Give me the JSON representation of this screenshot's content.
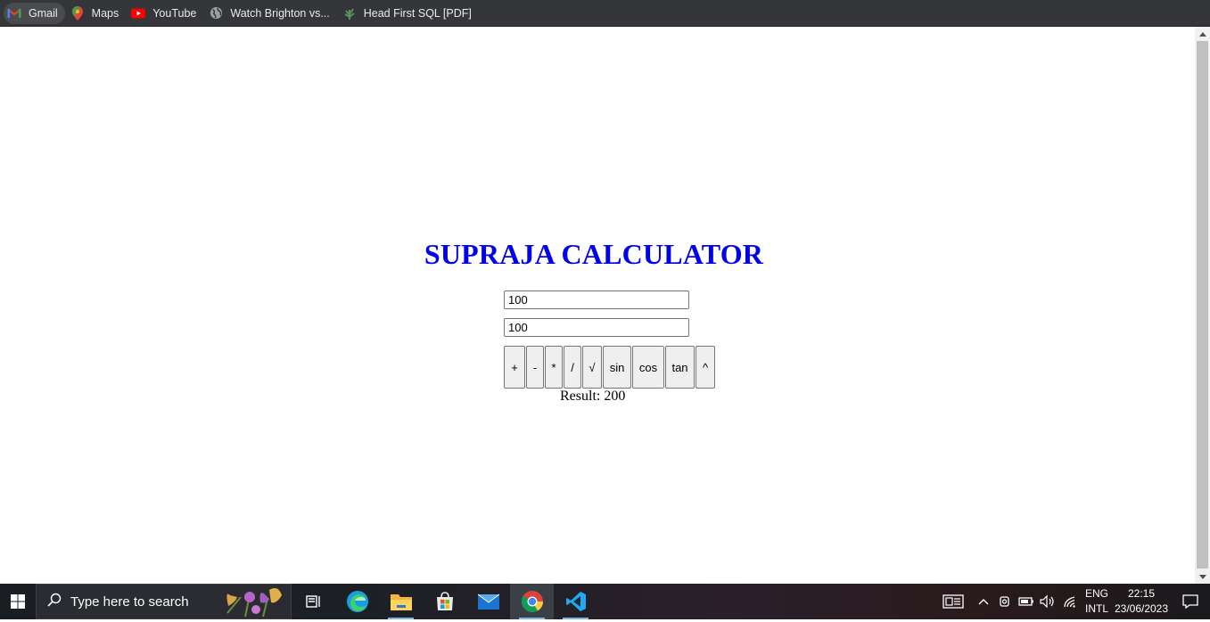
{
  "bookmarks": [
    {
      "label": "Gmail",
      "icon": "gmail-icon"
    },
    {
      "label": "Maps",
      "icon": "maps-icon"
    },
    {
      "label": "YouTube",
      "icon": "youtube-icon"
    },
    {
      "label": "Watch Brighton vs...",
      "icon": "globe-icon"
    },
    {
      "label": "Head First SQL [PDF]",
      "icon": "plant-icon"
    }
  ],
  "calculator": {
    "title": "SUPRAJA CALCULATOR",
    "input1": "100",
    "input2": "100",
    "buttons": [
      "+",
      "-",
      "*",
      "/",
      "√",
      "sin",
      "cos",
      "tan",
      "^"
    ],
    "result": "Result: 200"
  },
  "taskbar": {
    "search_placeholder": "Type here to search",
    "apps": [
      "task-view",
      "edge",
      "file-explorer",
      "microsoft-store",
      "mail",
      "chrome",
      "vscode"
    ],
    "language_top": "ENG",
    "language_bottom": "INTL",
    "time": "22:15",
    "date": "23/06/2023"
  }
}
